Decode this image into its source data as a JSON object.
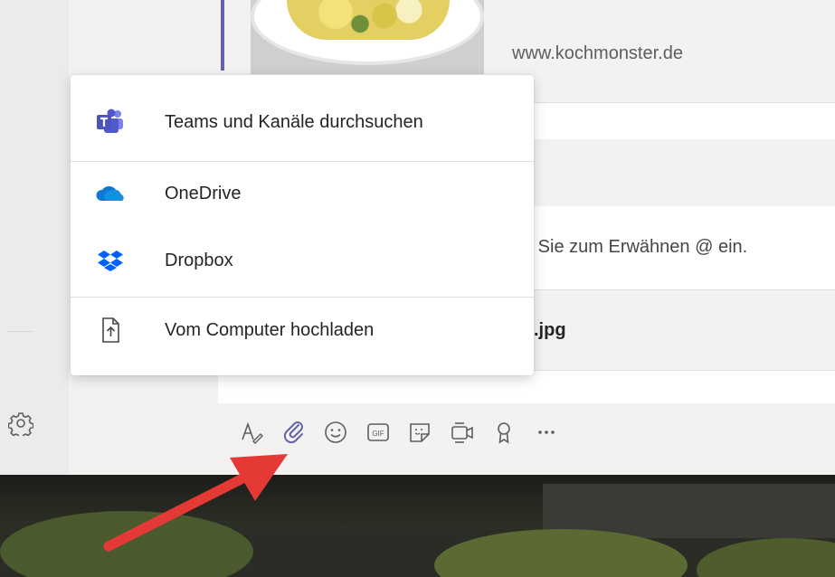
{
  "card": {
    "link_text": "www.kochmonster.de"
  },
  "compose": {
    "placeholder_fragment": "n Sie zum Erwähnen @ ein.",
    "attachment_name_fragment": ".jpg"
  },
  "attach_menu": {
    "items": [
      {
        "label": "Teams und Kanäle durchsuchen",
        "icon": "teams-icon"
      },
      {
        "label": "OneDrive",
        "icon": "onedrive-cloud-icon"
      },
      {
        "label": "Dropbox",
        "icon": "dropbox-icon"
      },
      {
        "label": "Vom Computer hochladen",
        "icon": "upload-file-icon"
      }
    ]
  },
  "toolbar": {
    "buttons": [
      {
        "icon": "format-icon"
      },
      {
        "icon": "attach-paperclip-icon"
      },
      {
        "icon": "emoji-icon"
      },
      {
        "icon": "gif-icon"
      },
      {
        "icon": "sticker-icon"
      },
      {
        "icon": "meet-now-icon"
      },
      {
        "icon": "praise-icon"
      },
      {
        "icon": "more-options-icon"
      }
    ],
    "gif_label": "GIF",
    "more_label": "•••"
  },
  "colors": {
    "teams_purple": "#6264a7",
    "onedrive_blue": "#0f78d4",
    "dropbox_blue": "#0061fe",
    "annotation_arrow_red": "#e53935"
  }
}
